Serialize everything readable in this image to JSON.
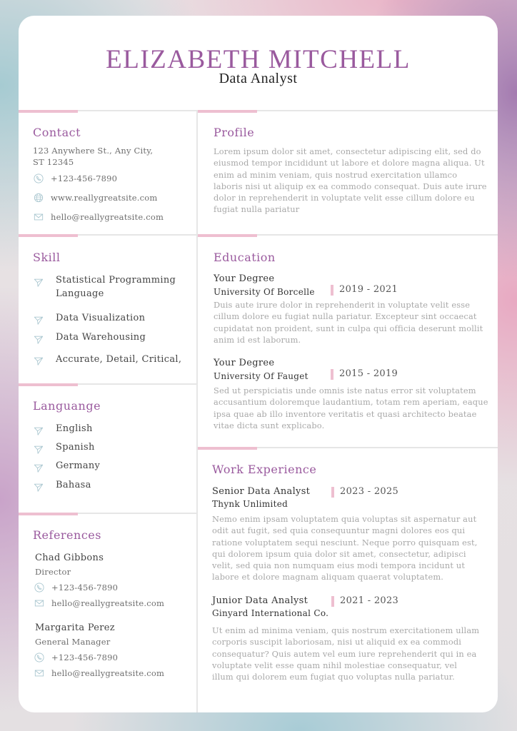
{
  "header": {
    "name": "ELIZABETH MITCHELL",
    "title": "Data Analyst"
  },
  "colors": {
    "accent_purple": "#9a5a9e",
    "accent_pink": "#eebfd0",
    "icon_blue": "#a9c6cf"
  },
  "contact": {
    "heading": "Contact",
    "address_line1": "123 Anywhere St., Any City,",
    "address_line2": "ST 12345",
    "phone": "+123-456-7890",
    "website": "www.reallygreatsite.com",
    "email": "hello@reallygreatsite.com"
  },
  "skill": {
    "heading": "Skill",
    "items": [
      {
        "line1": "Statistical Programming",
        "line2": "Language"
      },
      {
        "line1": "Data Visualization"
      },
      {
        "line1": "Data Warehousing"
      },
      {
        "line1": "Accurate, Detail, Critical,"
      }
    ]
  },
  "language": {
    "heading": "Languange",
    "items": [
      "English",
      "Spanish",
      "Germany",
      "Bahasa"
    ]
  },
  "references": {
    "heading": "References",
    "people": [
      {
        "name": "Chad Gibbons",
        "role": "Director",
        "phone": "+123-456-7890",
        "email": "hello@reallygreatsite.com"
      },
      {
        "name": "Margarita Perez",
        "role": "General Manager",
        "phone": "+123-456-7890",
        "email": "hello@reallygreatsite.com"
      }
    ]
  },
  "profile": {
    "heading": "Profile",
    "lines": [
      "Lorem ipsum dolor sit amet, consectetur adipiscing elit, sed do",
      "eiusmod tempor incididunt ut labore et dolore magna aliqua. Ut",
      "enim ad minim veniam, quis nostrud exercitation ullamco",
      "laboris nisi ut aliquip ex ea commodo consequat. Duis aute irure",
      "dolor in reprehenderit in voluptate velit esse cillum dolore eu",
      "fugiat nulla pariatur"
    ]
  },
  "education": {
    "heading": "Education",
    "entries": [
      {
        "degree": "Your Degree",
        "school": "University Of Borcelle",
        "years": "2019 - 2021",
        "lines": [
          "Duis aute irure dolor in reprehenderit in voluptate velit esse",
          "cillum dolore eu fugiat nulla pariatur. Excepteur sint occaecat",
          "cupidatat non proident, sunt in culpa qui officia deserunt mollit",
          "anim id est laborum."
        ]
      },
      {
        "degree": "Your Degree",
        "school": "University Of Fauget",
        "years": "2015 - 2019",
        "lines": [
          "Sed ut perspiciatis unde omnis iste natus error sit voluptatem",
          "accusantium doloremque laudantium, totam rem aperiam, eaque",
          "ipsa quae ab illo inventore veritatis et quasi architecto beatae",
          "vitae dicta sunt explicabo."
        ]
      }
    ]
  },
  "experience": {
    "heading": "Work Experience",
    "entries": [
      {
        "title": "Senior Data Analyst",
        "company": "Thynk Unlimited",
        "years": "2023 - 2025",
        "lines": [
          "Nemo enim ipsam voluptatem quia voluptas sit aspernatur aut",
          "odit aut fugit, sed quia consequuntur magni dolores eos qui",
          "ratione voluptatem sequi nesciunt. Neque porro quisquam est,",
          "qui dolorem ipsum quia dolor sit amet, consectetur, adipisci",
          "velit, sed quia non numquam eius modi tempora incidunt ut",
          "labore et dolore magnam aliquam quaerat voluptatem."
        ]
      },
      {
        "title": "Junior Data Analyst",
        "company": "Ginyard International Co.",
        "years": "2021 - 2023",
        "lines": [
          "Ut enim ad minima veniam, quis nostrum exercitationem ullam",
          "corporis suscipit laboriosam, nisi ut aliquid ex ea commodi",
          "consequatur? Quis autem vel eum iure reprehenderit qui in ea",
          "voluptate velit esse quam nihil molestiae consequatur, vel",
          "illum qui dolorem eum fugiat quo voluptas nulla pariatur."
        ]
      }
    ]
  }
}
